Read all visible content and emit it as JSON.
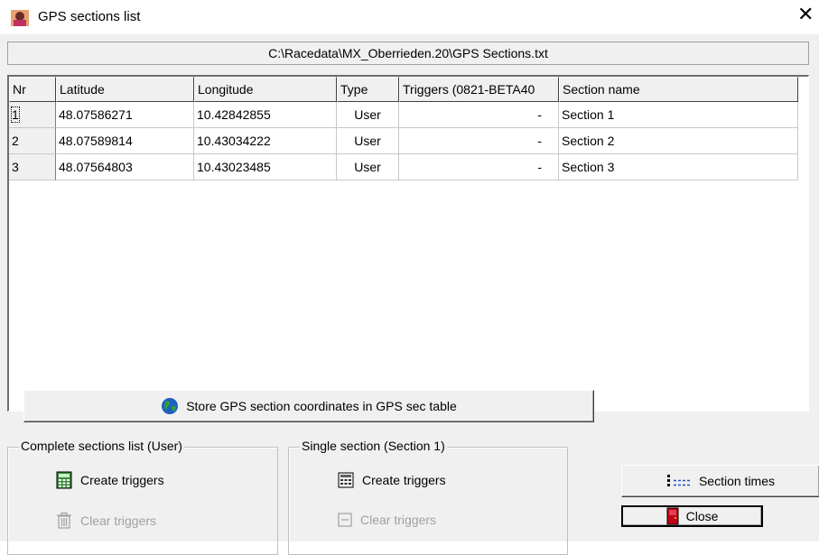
{
  "window": {
    "title": "GPS sections list"
  },
  "file_path": "C:\\Racedata\\MX_Oberrieden.20\\GPS Sections.txt",
  "table": {
    "columns": [
      "Nr",
      "Latitude",
      "Longitude",
      "Type",
      "Triggers (0821-BETA40",
      "Section name"
    ],
    "rows": [
      [
        "1",
        "48.07586271",
        "10.42842855",
        "User",
        "-",
        "Section 1"
      ],
      [
        "2",
        "48.07589814",
        "10.43034222",
        "User",
        "-",
        "Section 2"
      ],
      [
        "3",
        "48.07564803",
        "10.43023485",
        "User",
        "-",
        "Section 3"
      ]
    ]
  },
  "store_button": {
    "label": "Store GPS section coordinates in GPS sec table",
    "icon": "globe-icon"
  },
  "group_complete": {
    "legend": "Complete sections list  (User)",
    "create_label": "Create triggers",
    "clear_label": "Clear triggers"
  },
  "group_single": {
    "legend": "Single section  (Section 1)",
    "create_label": "Create triggers",
    "clear_label": "Clear triggers"
  },
  "buttons": {
    "section_times": "Section times",
    "close": "Close"
  },
  "colors": {
    "face": "#f0f0f0",
    "disabled_text": "#a0a0a0",
    "globe": "#1f5fbf",
    "door": "#c0001a"
  }
}
